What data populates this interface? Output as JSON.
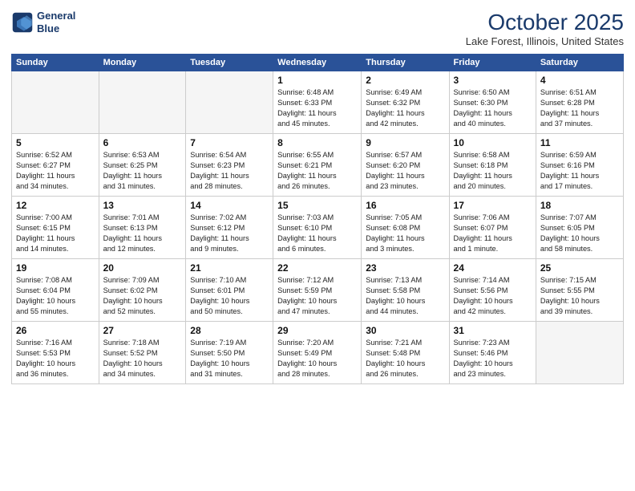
{
  "header": {
    "logo_line1": "General",
    "logo_line2": "Blue",
    "month_title": "October 2025",
    "location": "Lake Forest, Illinois, United States"
  },
  "weekdays": [
    "Sunday",
    "Monday",
    "Tuesday",
    "Wednesday",
    "Thursday",
    "Friday",
    "Saturday"
  ],
  "weeks": [
    [
      {
        "day": "",
        "info": ""
      },
      {
        "day": "",
        "info": ""
      },
      {
        "day": "",
        "info": ""
      },
      {
        "day": "1",
        "info": "Sunrise: 6:48 AM\nSunset: 6:33 PM\nDaylight: 11 hours\nand 45 minutes."
      },
      {
        "day": "2",
        "info": "Sunrise: 6:49 AM\nSunset: 6:32 PM\nDaylight: 11 hours\nand 42 minutes."
      },
      {
        "day": "3",
        "info": "Sunrise: 6:50 AM\nSunset: 6:30 PM\nDaylight: 11 hours\nand 40 minutes."
      },
      {
        "day": "4",
        "info": "Sunrise: 6:51 AM\nSunset: 6:28 PM\nDaylight: 11 hours\nand 37 minutes."
      }
    ],
    [
      {
        "day": "5",
        "info": "Sunrise: 6:52 AM\nSunset: 6:27 PM\nDaylight: 11 hours\nand 34 minutes."
      },
      {
        "day": "6",
        "info": "Sunrise: 6:53 AM\nSunset: 6:25 PM\nDaylight: 11 hours\nand 31 minutes."
      },
      {
        "day": "7",
        "info": "Sunrise: 6:54 AM\nSunset: 6:23 PM\nDaylight: 11 hours\nand 28 minutes."
      },
      {
        "day": "8",
        "info": "Sunrise: 6:55 AM\nSunset: 6:21 PM\nDaylight: 11 hours\nand 26 minutes."
      },
      {
        "day": "9",
        "info": "Sunrise: 6:57 AM\nSunset: 6:20 PM\nDaylight: 11 hours\nand 23 minutes."
      },
      {
        "day": "10",
        "info": "Sunrise: 6:58 AM\nSunset: 6:18 PM\nDaylight: 11 hours\nand 20 minutes."
      },
      {
        "day": "11",
        "info": "Sunrise: 6:59 AM\nSunset: 6:16 PM\nDaylight: 11 hours\nand 17 minutes."
      }
    ],
    [
      {
        "day": "12",
        "info": "Sunrise: 7:00 AM\nSunset: 6:15 PM\nDaylight: 11 hours\nand 14 minutes."
      },
      {
        "day": "13",
        "info": "Sunrise: 7:01 AM\nSunset: 6:13 PM\nDaylight: 11 hours\nand 12 minutes."
      },
      {
        "day": "14",
        "info": "Sunrise: 7:02 AM\nSunset: 6:12 PM\nDaylight: 11 hours\nand 9 minutes."
      },
      {
        "day": "15",
        "info": "Sunrise: 7:03 AM\nSunset: 6:10 PM\nDaylight: 11 hours\nand 6 minutes."
      },
      {
        "day": "16",
        "info": "Sunrise: 7:05 AM\nSunset: 6:08 PM\nDaylight: 11 hours\nand 3 minutes."
      },
      {
        "day": "17",
        "info": "Sunrise: 7:06 AM\nSunset: 6:07 PM\nDaylight: 11 hours\nand 1 minute."
      },
      {
        "day": "18",
        "info": "Sunrise: 7:07 AM\nSunset: 6:05 PM\nDaylight: 10 hours\nand 58 minutes."
      }
    ],
    [
      {
        "day": "19",
        "info": "Sunrise: 7:08 AM\nSunset: 6:04 PM\nDaylight: 10 hours\nand 55 minutes."
      },
      {
        "day": "20",
        "info": "Sunrise: 7:09 AM\nSunset: 6:02 PM\nDaylight: 10 hours\nand 52 minutes."
      },
      {
        "day": "21",
        "info": "Sunrise: 7:10 AM\nSunset: 6:01 PM\nDaylight: 10 hours\nand 50 minutes."
      },
      {
        "day": "22",
        "info": "Sunrise: 7:12 AM\nSunset: 5:59 PM\nDaylight: 10 hours\nand 47 minutes."
      },
      {
        "day": "23",
        "info": "Sunrise: 7:13 AM\nSunset: 5:58 PM\nDaylight: 10 hours\nand 44 minutes."
      },
      {
        "day": "24",
        "info": "Sunrise: 7:14 AM\nSunset: 5:56 PM\nDaylight: 10 hours\nand 42 minutes."
      },
      {
        "day": "25",
        "info": "Sunrise: 7:15 AM\nSunset: 5:55 PM\nDaylight: 10 hours\nand 39 minutes."
      }
    ],
    [
      {
        "day": "26",
        "info": "Sunrise: 7:16 AM\nSunset: 5:53 PM\nDaylight: 10 hours\nand 36 minutes."
      },
      {
        "day": "27",
        "info": "Sunrise: 7:18 AM\nSunset: 5:52 PM\nDaylight: 10 hours\nand 34 minutes."
      },
      {
        "day": "28",
        "info": "Sunrise: 7:19 AM\nSunset: 5:50 PM\nDaylight: 10 hours\nand 31 minutes."
      },
      {
        "day": "29",
        "info": "Sunrise: 7:20 AM\nSunset: 5:49 PM\nDaylight: 10 hours\nand 28 minutes."
      },
      {
        "day": "30",
        "info": "Sunrise: 7:21 AM\nSunset: 5:48 PM\nDaylight: 10 hours\nand 26 minutes."
      },
      {
        "day": "31",
        "info": "Sunrise: 7:23 AM\nSunset: 5:46 PM\nDaylight: 10 hours\nand 23 minutes."
      },
      {
        "day": "",
        "info": ""
      }
    ]
  ]
}
